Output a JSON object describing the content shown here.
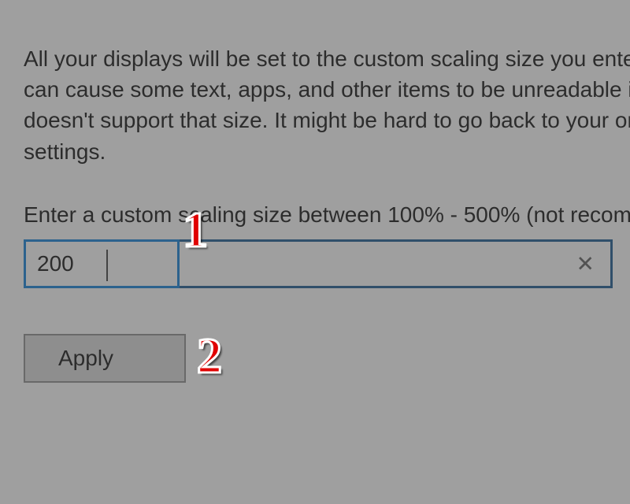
{
  "description_lines": [
    "All your displays will be set to the custom scaling size you enter here. This",
    "can cause some text, apps, and other items to be unreadable if your display",
    "doesn't support that size. It might be hard to go back to your original",
    "settings."
  ],
  "instruction": "Enter a custom scaling size between 100% - 500% (not recommended)",
  "input_value": "200",
  "clear_symbol": "✕",
  "apply_label": "Apply",
  "annotations": {
    "step1": "1",
    "step2": "2"
  }
}
